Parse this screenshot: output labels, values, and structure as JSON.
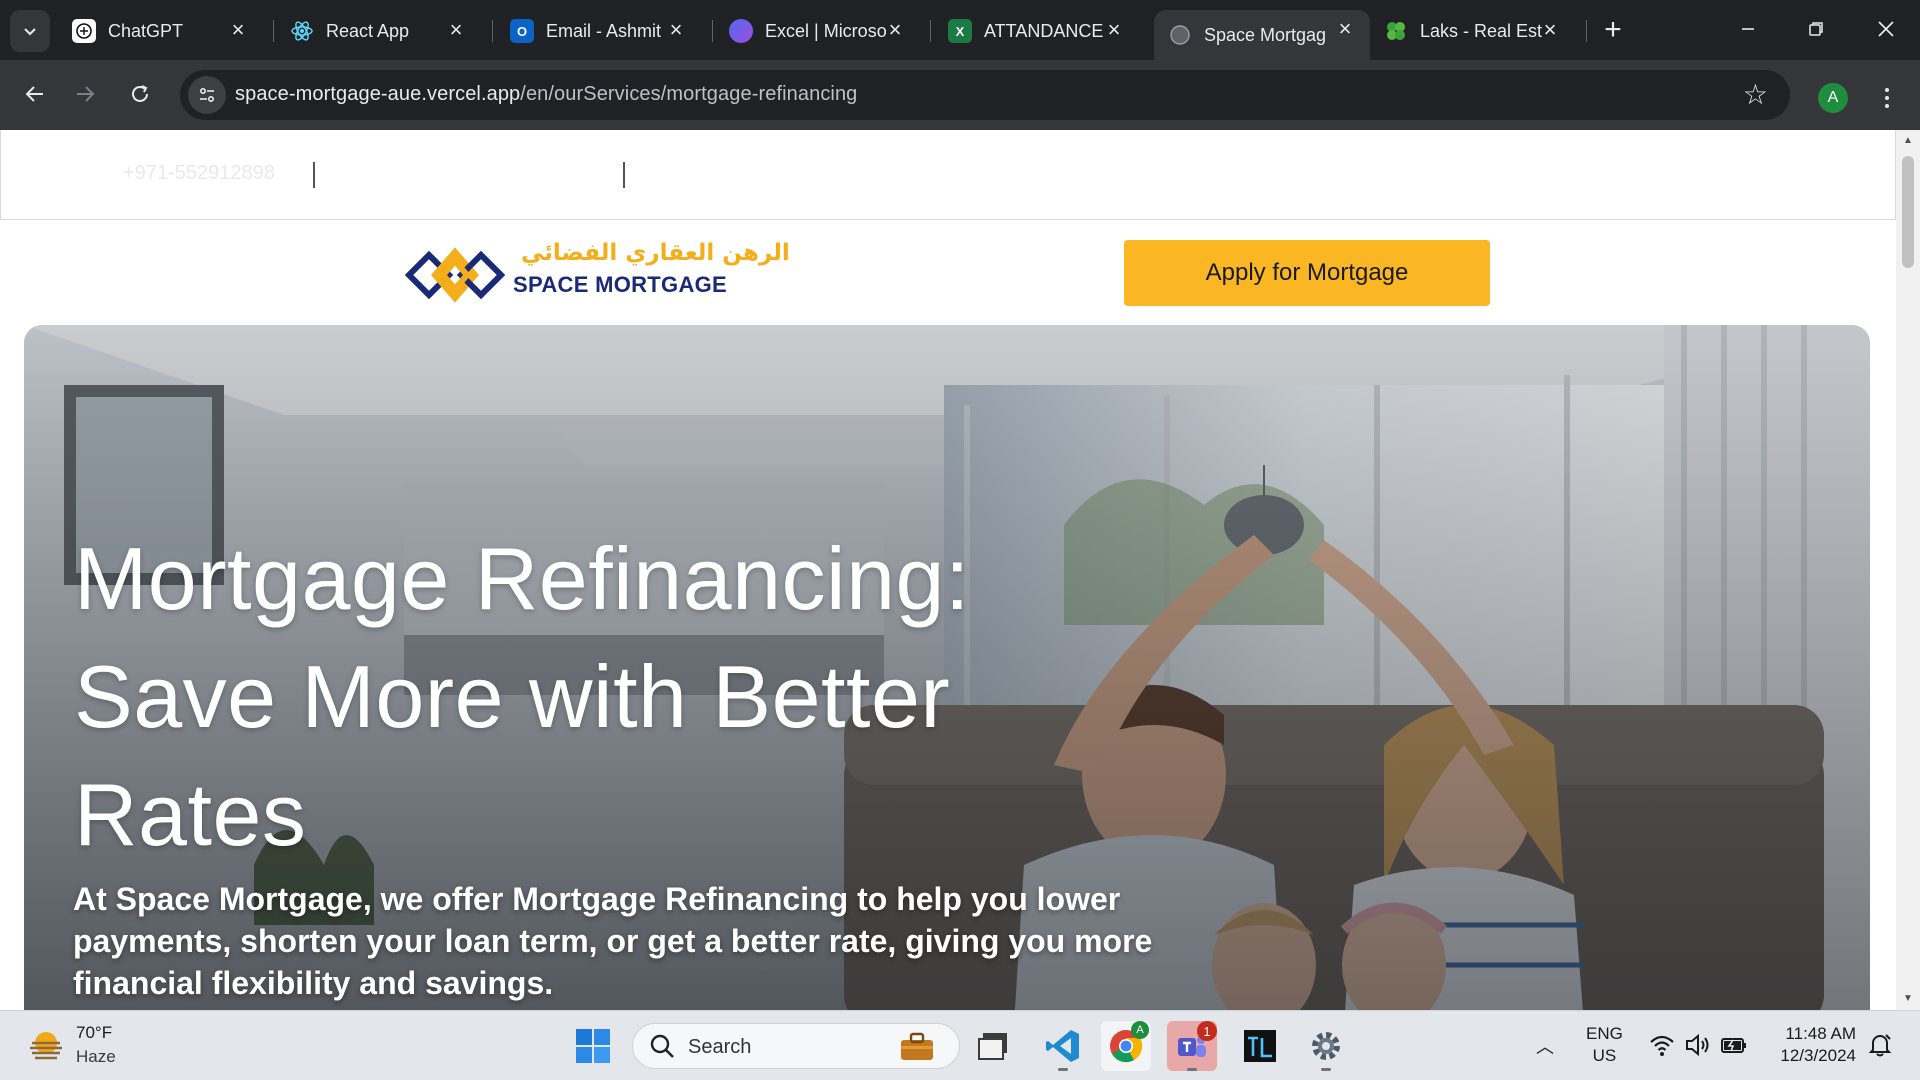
{
  "browser": {
    "tabs": [
      {
        "label": "ChatGPT",
        "icon": "chatgpt-icon",
        "active": false
      },
      {
        "label": "React App",
        "icon": "react-icon",
        "active": false
      },
      {
        "label": "Email - Ashmit",
        "icon": "outlook-icon",
        "active": false
      },
      {
        "label": "Excel | Microso",
        "icon": "copilot-icon",
        "active": false
      },
      {
        "label": "ATTANDANCE",
        "icon": "excel-icon",
        "active": false
      },
      {
        "label": "Space Mortgag",
        "icon": "globe-icon",
        "active": true
      },
      {
        "label": "Laks - Real Est",
        "icon": "clover-icon",
        "active": false
      }
    ],
    "address": {
      "domain": "space-mortgage-aue.vercel.app",
      "path": "/en/ourServices/mortgage-refinancing"
    },
    "profile_initial": "A"
  },
  "page": {
    "topbar": {
      "phone": "+971-552912898"
    },
    "logo": {
      "arabic": "الرهن العقاري الفضائي",
      "english": "SPACE MORTGAGE"
    },
    "apply_button": "Apply for Mortgage",
    "hero": {
      "title_line1": "Mortgage Refinancing:",
      "title_line2": "Save More with Better",
      "title_line3": "Rates",
      "description": "At Space Mortgage, we offer Mortgage Refinancing to help you lower payments, shorten your loan term, or get a better rate, giving you more financial flexibility and savings."
    }
  },
  "taskbar": {
    "weather": {
      "temp": "70°F",
      "desc": "Haze"
    },
    "search_label": "Search",
    "teams_badge": "1",
    "chrome_badge": "A",
    "language": {
      "line1": "ENG",
      "line2": "US"
    },
    "clock": {
      "time": "11:48 AM",
      "date": "12/3/2024"
    }
  },
  "colors": {
    "accent_yellow": "#fab623",
    "logo_navy": "#1b2a78",
    "logo_gold": "#f3ae1a",
    "chrome_dark": "#202124",
    "chrome_toolbar": "#35363a"
  }
}
